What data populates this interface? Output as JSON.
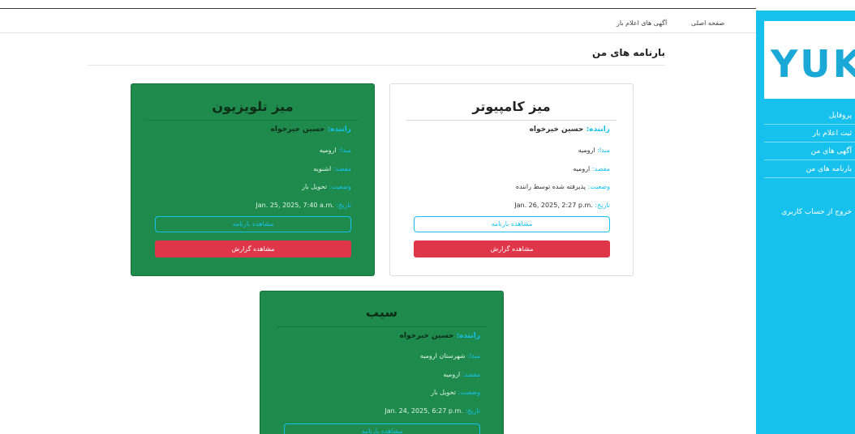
{
  "sidebar": {
    "logo": "YUK",
    "menu": [
      "پروفایل",
      "ثبت اعلام بار",
      "آگهی های من",
      "بارنامه های من"
    ],
    "logout": "خروج از حساب کاربری"
  },
  "topnav": {
    "home": "صفحه اصلی",
    "ads": "آگهی های اعلام بار"
  },
  "page_title": "بارنامه های من",
  "labels": {
    "driver": "راننده:",
    "origin": "مبدا:",
    "destination": "مقصد:",
    "status": "وضعیت:",
    "date": "تاریخ:",
    "view_waybill": "مشاهده بارنامه",
    "view_report": "مشاهده گزارش"
  },
  "cards": [
    {
      "title": "میز کامپیوتر",
      "driver": "حسین خیرخواه",
      "origin": "ارومیه",
      "destination": "ارومیه",
      "status": "پذیرفته شده توسط راننده",
      "date": "Jan. 26, 2025, 2:27 p.m."
    },
    {
      "title": "میز تلویزیون",
      "driver": "حسین خیرخواه",
      "origin": "ارومیه",
      "destination": "اشنویه",
      "status": "تحویل بار",
      "date": "Jan. 25, 2025, 7:40 a.m."
    },
    {
      "title": "سیب",
      "driver": "حسین خیرخواه",
      "origin": "شهرستان ارومیه",
      "destination": "ارومیه",
      "status": "تحویل بار",
      "date": "Jan. 24, 2025, 6:27 p.m."
    }
  ],
  "colors": {
    "sidebar": "#17c1ee",
    "card_green": "#1e8a4c",
    "accent": "#17c1ee",
    "danger": "#e0364a"
  }
}
